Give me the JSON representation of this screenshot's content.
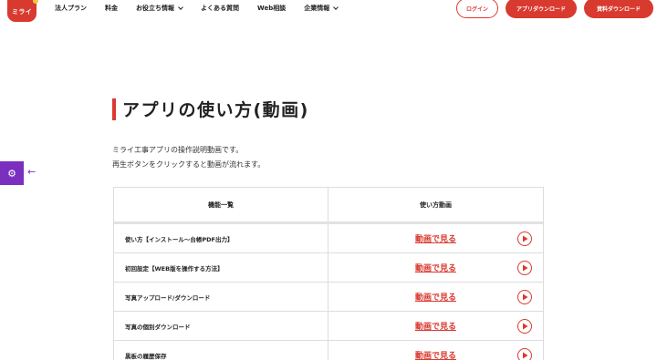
{
  "header": {
    "logo_text": "ミライ",
    "nav": [
      {
        "label": "法人プラン",
        "has_dropdown": false
      },
      {
        "label": "料金",
        "has_dropdown": false
      },
      {
        "label": "お役立ち情報",
        "has_dropdown": true
      },
      {
        "label": "よくある質問",
        "has_dropdown": false
      },
      {
        "label": "Web相談",
        "has_dropdown": false
      },
      {
        "label": "企業情報",
        "has_dropdown": true
      }
    ],
    "login_label": "ログイン",
    "app_download_label": "アプリダウンロード",
    "doc_download_label": "資料ダウンロード"
  },
  "side_widget": {
    "gear_icon": "gear-icon",
    "arrow_icon": "arrow-left-icon"
  },
  "main": {
    "title": "アプリの使い方(動画)",
    "description_line1": "ミライ工事アプリの操作説明動画です。",
    "description_line2": "再生ボタンをクリックすると動画が流れます。"
  },
  "table": {
    "headers": [
      "機能一覧",
      "使い方動画"
    ],
    "rows": [
      {
        "feature": "使い方【インストール～台帳PDF出力】",
        "link": "動画で見る"
      },
      {
        "feature": "初回設定【WEB版を操作する方法】",
        "link": "動画で見る"
      },
      {
        "feature": "写真アップロード/ダウンロード",
        "link": "動画で見る"
      },
      {
        "feature": "写真の個別ダウンロード",
        "link": "動画で見る"
      },
      {
        "feature": "黒板の履歴保存",
        "link": "動画で見る"
      }
    ]
  },
  "colors": {
    "brand_red": "#d93a2f",
    "widget_purple": "#7b2fbe"
  }
}
